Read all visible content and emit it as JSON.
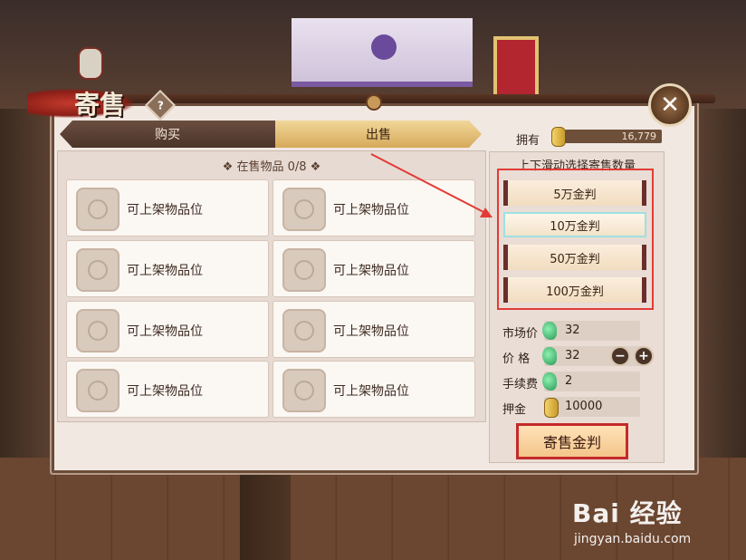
{
  "window": {
    "title": "寄售",
    "help_symbol": "?",
    "close_symbol": "✕"
  },
  "tabs": [
    {
      "label": "购买",
      "active": false
    },
    {
      "label": "出售",
      "active": true
    }
  ],
  "listing": {
    "header": "在售物品 0/8",
    "slots": [
      "可上架物品位",
      "可上架物品位",
      "可上架物品位",
      "可上架物品位",
      "可上架物品位",
      "可上架物品位",
      "可上架物品位",
      "可上架物品位"
    ]
  },
  "owned": {
    "label": "拥有",
    "value": "16,779"
  },
  "amount_picker": {
    "title": "上下滑动选择寄售数量",
    "options": [
      "5万金判",
      "10万金判",
      "50万金判",
      "100万金判"
    ],
    "selected_index": 1
  },
  "stats": {
    "market_price_label": "市场价",
    "market_price_value": "32",
    "price_label": "价  格",
    "price_value": "32",
    "minus_symbol": "−",
    "plus_symbol": "+",
    "fee_label": "手续费",
    "fee_value": "2",
    "deposit_label": "押金",
    "deposit_value": "10000"
  },
  "sell_button": "寄售金判",
  "watermark": {
    "logo": "Bai 经验",
    "url": "jingyan.baidu.com"
  },
  "colors": {
    "highlight_frame": "#e23b36",
    "tab_active": "#d6a95a",
    "tab_inactive": "#4a3428"
  }
}
